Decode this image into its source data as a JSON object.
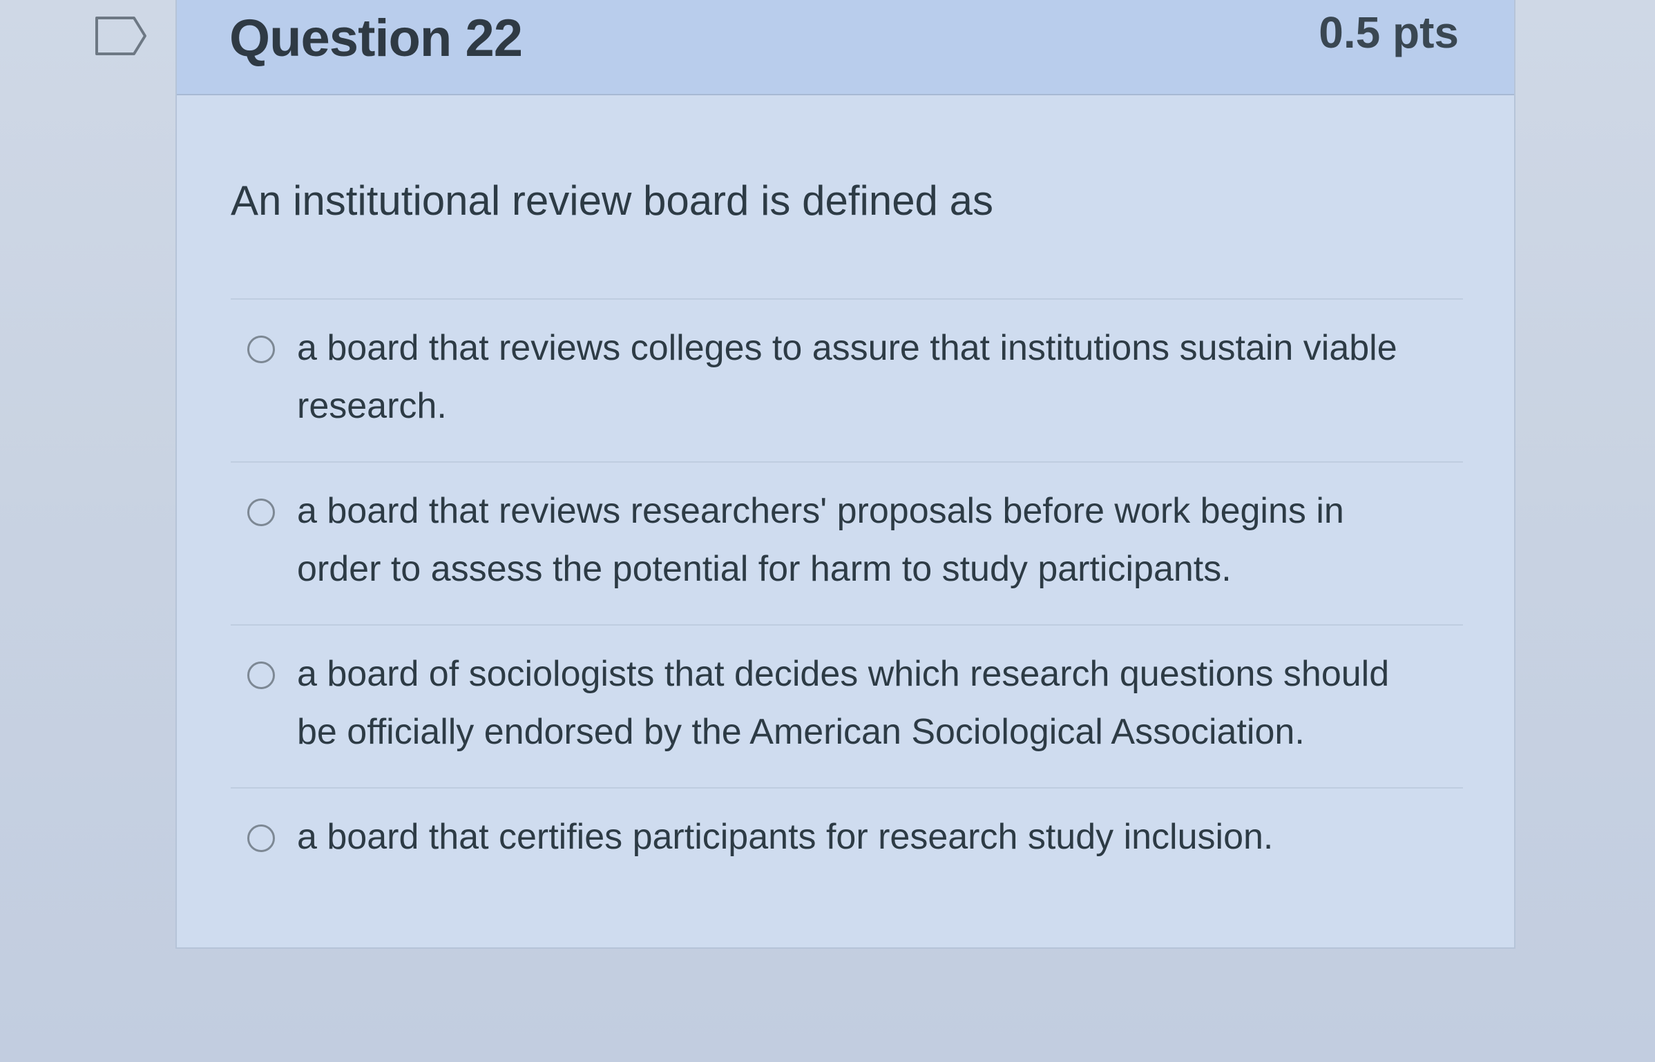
{
  "question": {
    "title": "Question 22",
    "points": "0.5 pts",
    "text": "An institutional review board is defined as"
  },
  "answers": [
    {
      "label": "a board that reviews colleges to assure that institutions sustain viable research.",
      "selected": false
    },
    {
      "label": "a board that reviews researchers' proposals before work begins in order to assess the potential for harm to study participants.",
      "selected": false
    },
    {
      "label": "a board of sociologists that decides which research questions should be officially endorsed by the American Sociological Association.",
      "selected": false
    },
    {
      "label": "a board that certifies participants for research study inclusion.",
      "selected": false
    }
  ],
  "icons": {
    "flag": "flag-outline-icon",
    "radio": "radio-unselected-icon"
  },
  "colors": {
    "header_bg": "#b9cdec",
    "card_bg": "#cfdcef",
    "text": "#2d3b45",
    "radio_border": "#7d8894"
  }
}
